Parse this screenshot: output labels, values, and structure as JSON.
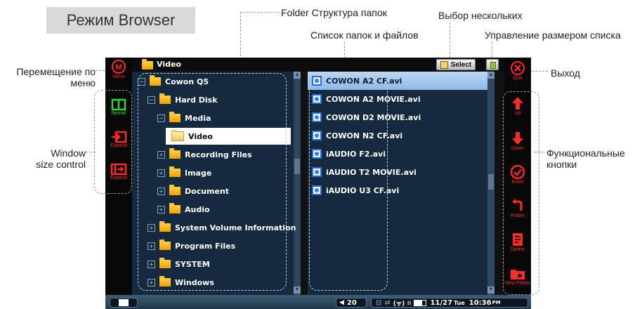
{
  "mode_title": "Режим Browser",
  "callouts": {
    "folder_structure": "Folder Структура папок",
    "multi_select": "Выбор нескольких",
    "file_list": "Список папок и файлов",
    "list_size": "Управление размером списка",
    "menu_move_line1": "Перемещение по",
    "menu_move_line2": "меню",
    "exit": "Выход",
    "window_size_line1": "Window",
    "window_size_line2": "size control",
    "function_buttons_line1": "Функциональные",
    "function_buttons_line2": "кнопки"
  },
  "header": {
    "current_folder": "Video",
    "select_label": "Select"
  },
  "left_buttons": [
    {
      "label": "Menu",
      "icon": "menu-icon"
    },
    {
      "label": "Nomal",
      "icon": "normal-window-icon"
    },
    {
      "label": "Expand",
      "icon": "expand-icon"
    },
    {
      "label": "Expand",
      "icon": "expand-full-icon"
    }
  ],
  "right_buttons": [
    {
      "label": "Quit",
      "icon": "quit-icon"
    },
    {
      "label": "Up",
      "icon": "arrow-up-icon"
    },
    {
      "label": "Down",
      "icon": "arrow-down-icon"
    },
    {
      "label": "Enter",
      "icon": "enter-icon"
    },
    {
      "label": "Folder",
      "icon": "folder-back-icon"
    },
    {
      "label": "Delete",
      "icon": "delete-icon"
    },
    {
      "label": "New Folder",
      "icon": "new-folder-icon"
    }
  ],
  "tree": [
    {
      "label": "Cowon Q5",
      "expander": "−",
      "level": 0
    },
    {
      "label": "Hard Disk",
      "expander": "−",
      "level": 1
    },
    {
      "label": "Media",
      "expander": "−",
      "level": 2
    },
    {
      "label": "Video",
      "expander": "",
      "level": 3,
      "selected": true
    },
    {
      "label": "Recording Files",
      "expander": "+",
      "level": 2
    },
    {
      "label": "Image",
      "expander": "+",
      "level": 2
    },
    {
      "label": "Document",
      "expander": "+",
      "level": 2
    },
    {
      "label": "Audio",
      "expander": "+",
      "level": 2
    },
    {
      "label": "System Volume Information",
      "expander": "+",
      "level": 1
    },
    {
      "label": "Program Files",
      "expander": "+",
      "level": 1
    },
    {
      "label": "SYSTEM",
      "expander": "+",
      "level": 1
    },
    {
      "label": "Windows",
      "expander": "+",
      "level": 1
    }
  ],
  "files": [
    {
      "name": "COWON A2 CF.avi",
      "selected": true
    },
    {
      "name": "COWON A2 MOVIE.avi"
    },
    {
      "name": "COWON D2 MOVIE.avi"
    },
    {
      "name": "COWON N2 CF.avi"
    },
    {
      "name": "iAUDIO F2.avi"
    },
    {
      "name": "iAUDIO T2 MOVIE.avi"
    },
    {
      "name": "iAUDIO U3 CF.avi"
    }
  ],
  "status": {
    "volume": "20",
    "wifi": "(ᯤ)",
    "date": "11/27",
    "day": "Tue",
    "time": "10:36",
    "ampm": "PM"
  }
}
